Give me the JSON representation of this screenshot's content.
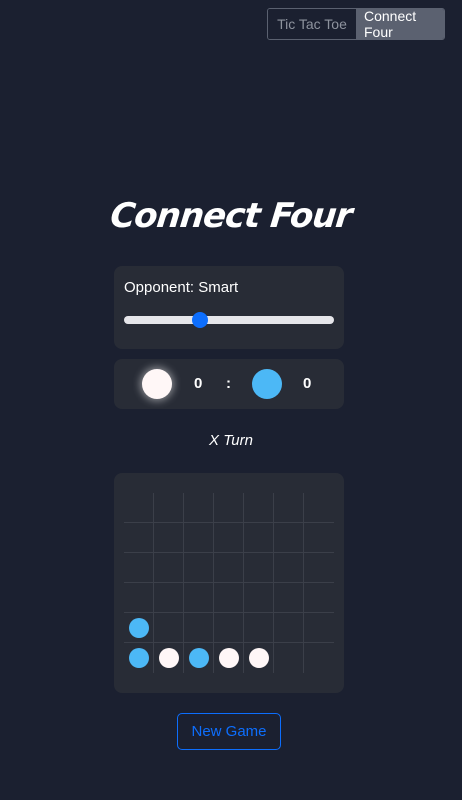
{
  "tabs": {
    "tic_tac_toe": "Tic Tac Toe",
    "connect_four": "Connect Four",
    "active": "connect_four"
  },
  "title": "Connect Four",
  "opponent": {
    "label": "Opponent: Smart",
    "level": 0.35
  },
  "score": {
    "white": "0",
    "separator": ":",
    "blue": "0"
  },
  "status": "X Turn",
  "board": {
    "columns": 7,
    "rows": 6,
    "pieces": [
      {
        "row": 5,
        "col": 0,
        "color": "blue"
      },
      {
        "row": 6,
        "col": 0,
        "color": "blue"
      },
      {
        "row": 6,
        "col": 1,
        "color": "white"
      },
      {
        "row": 6,
        "col": 2,
        "color": "blue"
      },
      {
        "row": 6,
        "col": 3,
        "color": "white"
      },
      {
        "row": 6,
        "col": 4,
        "color": "white"
      }
    ]
  },
  "new_game_label": "New Game",
  "colors": {
    "background": "#1b2030",
    "panel": "#282c36",
    "accent": "#0d6efd",
    "blue_disc": "#4cb8f6",
    "white_disc": "#fff7f7"
  }
}
